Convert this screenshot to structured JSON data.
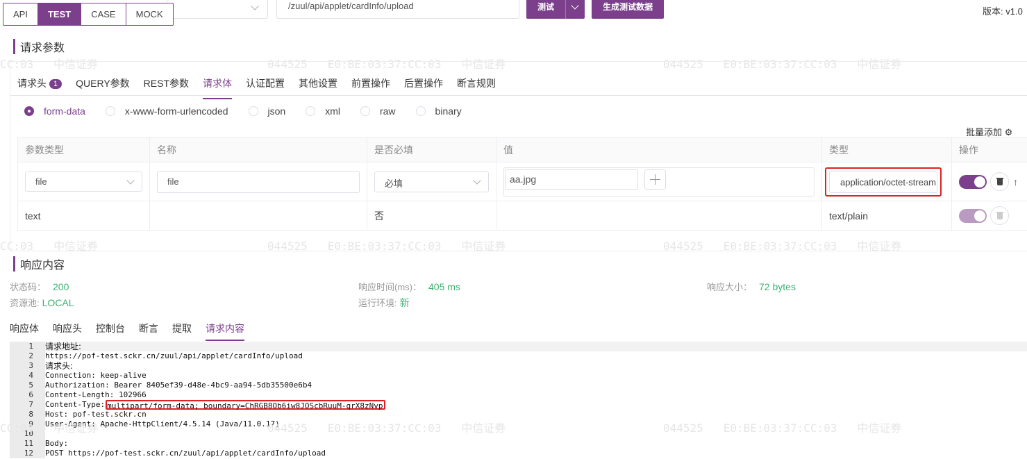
{
  "top": {
    "mode_tabs": [
      "API",
      "TEST",
      "CASE",
      "MOCK"
    ],
    "active_mode": "TEST",
    "url": "/zuul/api/applet/cardInfo/upload",
    "test_button": "测试",
    "generate_button": "生成测试数据",
    "version": "版本: v1.0"
  },
  "watermark": {
    "text_left": "CC:03   中信证券",
    "text_mid": "044525   E0:BE:03:37:CC:03   中信证券"
  },
  "request": {
    "section_title": "请求参数",
    "tabs": [
      "请求头",
      "QUERY参数",
      "REST参数",
      "请求体",
      "认证配置",
      "其他设置",
      "前置操作",
      "后置操作",
      "断言规则"
    ],
    "header_badge": "1",
    "active_tab": "请求体",
    "body_types": [
      "form-data",
      "x-www-form-urlencoded",
      "json",
      "xml",
      "raw",
      "binary"
    ],
    "selected_body_type": "form-data",
    "batch_add": "批量添加",
    "table": {
      "headers": [
        "参数类型",
        "名称",
        "是否必填",
        "值",
        "类型",
        "操作"
      ],
      "rows": [
        {
          "param_type": "file",
          "name": "file",
          "required": "必填",
          "value": "aa.jpg",
          "content_type": "application/octet-stream",
          "enabled": true
        },
        {
          "param_type": "text",
          "name": "",
          "required": "否",
          "value": "",
          "content_type": "text/plain",
          "enabled": true
        }
      ]
    }
  },
  "response": {
    "section_title": "响应内容",
    "status_label": "状态码：",
    "status_value": "200",
    "pool_label": "资源池:",
    "pool_value": "LOCAL",
    "time_label": "响应时间(ms)：",
    "time_value": "405 ms",
    "env_label": "运行环境:",
    "env_value": "新",
    "size_label": "响应大小：",
    "size_value": "72 bytes",
    "tabs": [
      "响应体",
      "响应头",
      "控制台",
      "断言",
      "提取",
      "请求内容"
    ],
    "active_tab": "请求内容",
    "code_lines": [
      {
        "n": "1",
        "text": "请求地址:"
      },
      {
        "n": "2",
        "text": "https://pof-test.sckr.cn/zuul/api/applet/cardInfo/upload"
      },
      {
        "n": "3",
        "text": "请求头:"
      },
      {
        "n": "4",
        "text": "Connection: keep-alive"
      },
      {
        "n": "5",
        "text": "Authorization: Bearer 8405ef39-d48e-4bc9-aa94-5db35500e6b4"
      },
      {
        "n": "6",
        "text": "Content-Length: 102966"
      },
      {
        "n": "7",
        "text": "Content-Type:",
        "highlight": "multipart/form-data; boundary=ChRGB8Ob6iw8JOScbRuuM-qrX8zNvp"
      },
      {
        "n": "8",
        "text": "Host: pof-test.sckr.cn"
      },
      {
        "n": "9",
        "text": "User-Agent: Apache-HttpClient/4.5.14 (Java/11.0.17)"
      },
      {
        "n": "10",
        "text": ""
      },
      {
        "n": "11",
        "text": "Body:"
      },
      {
        "n": "12",
        "text": "POST https://pof-test.sckr.cn/zuul/api/applet/cardInfo/upload"
      }
    ]
  },
  "colors": {
    "primary": "#7b3f8c",
    "highlight_border": "#e02020",
    "success": "#3cb371"
  }
}
